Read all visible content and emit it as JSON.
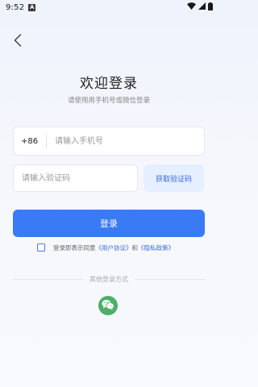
{
  "status_bar": {
    "time": "9:52",
    "notification_letter": "A",
    "icons": [
      "wifi-icon",
      "signal-icon",
      "battery-icon"
    ]
  },
  "nav": {
    "back_icon": "chevron-left-icon"
  },
  "header": {
    "title": "欢迎登录",
    "subtitle": "请使用用手机号或微信登录"
  },
  "form": {
    "country_code": "+86",
    "phone_placeholder": "请输入手机号",
    "phone_value": "",
    "code_placeholder": "请输入验证码",
    "code_value": "",
    "get_code_label": "获取验证码",
    "login_label": "登录"
  },
  "agreement": {
    "checked": false,
    "prefix": "登录即表示同意",
    "user_agreement": "《用户协议》",
    "conjunction": "和",
    "privacy_policy": "《隐私政策》"
  },
  "other_login": {
    "label": "其他登录方式",
    "wechat_icon": "wechat-icon"
  },
  "colors": {
    "primary": "#3b7af5",
    "link": "#3a6bd8",
    "code_button_bg": "#e6efff",
    "wechat": "#4caf6a"
  }
}
